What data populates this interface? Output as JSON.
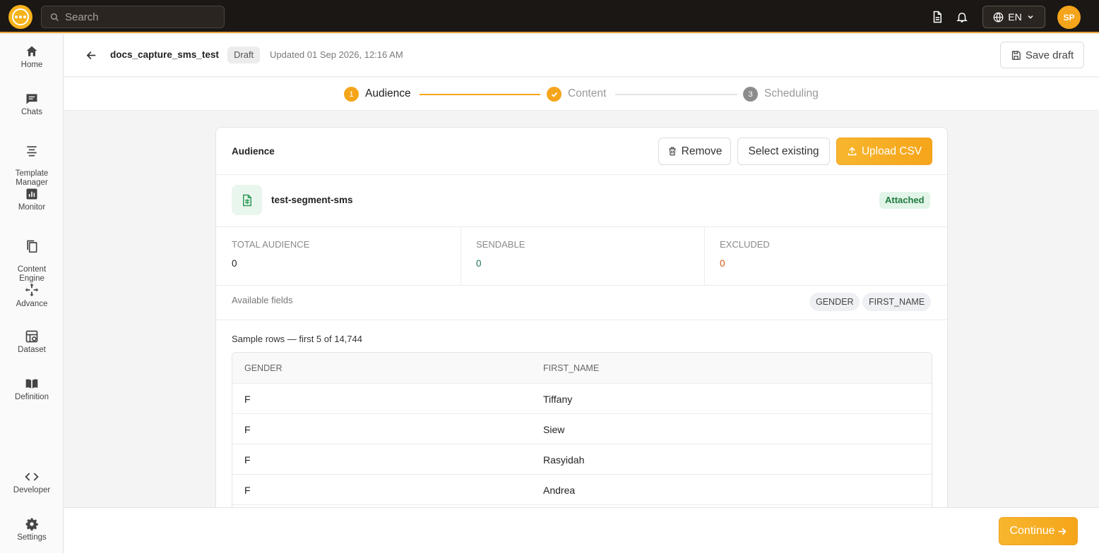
{
  "topbar": {
    "search_placeholder": "Search",
    "language": "EN",
    "avatar_initials": "SP"
  },
  "sidebar": {
    "items": [
      {
        "label": "Home",
        "icon": "home-icon"
      },
      {
        "label": "Chats",
        "icon": "chat-icon"
      },
      {
        "label": "Template\nManager",
        "icon": "template-icon"
      },
      {
        "label": "Monitor",
        "icon": "monitor-icon"
      },
      {
        "label": "Content\nEngine",
        "icon": "content-engine-icon"
      },
      {
        "label": "Advance",
        "icon": "advance-icon"
      },
      {
        "label": "Dataset",
        "icon": "dataset-icon"
      },
      {
        "label": "Definition",
        "icon": "definition-icon"
      },
      {
        "label": "Developer",
        "icon": "code-icon"
      },
      {
        "label": "Settings",
        "icon": "gear-icon"
      }
    ]
  },
  "header": {
    "campaign_name": "docs_capture_sms_test",
    "status": "Draft",
    "updated": "Updated 01 Sep 2026, 12:16 AM",
    "save_draft_label": "Save draft"
  },
  "stepper": {
    "steps": [
      {
        "number": "1",
        "label": "Audience",
        "state": "active"
      },
      {
        "number": "2",
        "label": "Content",
        "state": "completed"
      },
      {
        "number": "3",
        "label": "Scheduling",
        "state": "pending"
      }
    ]
  },
  "audience": {
    "title": "Audience",
    "remove_label": "Remove",
    "select_existing_label": "Select existing",
    "upload_label": "Upload CSV",
    "segment_name": "test-segment-sms",
    "segment_status": "Attached",
    "stats": [
      {
        "label": "TOTAL AUDIENCE",
        "value": "0",
        "color": "#222222"
      },
      {
        "label": "SENDABLE",
        "value": "0",
        "color": "#1f6f5f"
      },
      {
        "label": "EXCLUDED",
        "value": "0",
        "color": "#d2570f"
      }
    ],
    "available_fields_label": "Available fields",
    "fields": [
      "GENDER",
      "FIRST_NAME"
    ],
    "sample_label": "Sample rows — first 5 of 14,744",
    "table": {
      "columns": [
        "GENDER",
        "FIRST_NAME"
      ],
      "rows": [
        [
          "F",
          "Tiffany"
        ],
        [
          "F",
          "Siew"
        ],
        [
          "F",
          "Rasyidah"
        ],
        [
          "F",
          "Andrea"
        ]
      ]
    }
  },
  "footer": {
    "continue_label": "Continue"
  },
  "colors": {
    "accent": "#f6a51a",
    "topbar": "#1b1714"
  }
}
